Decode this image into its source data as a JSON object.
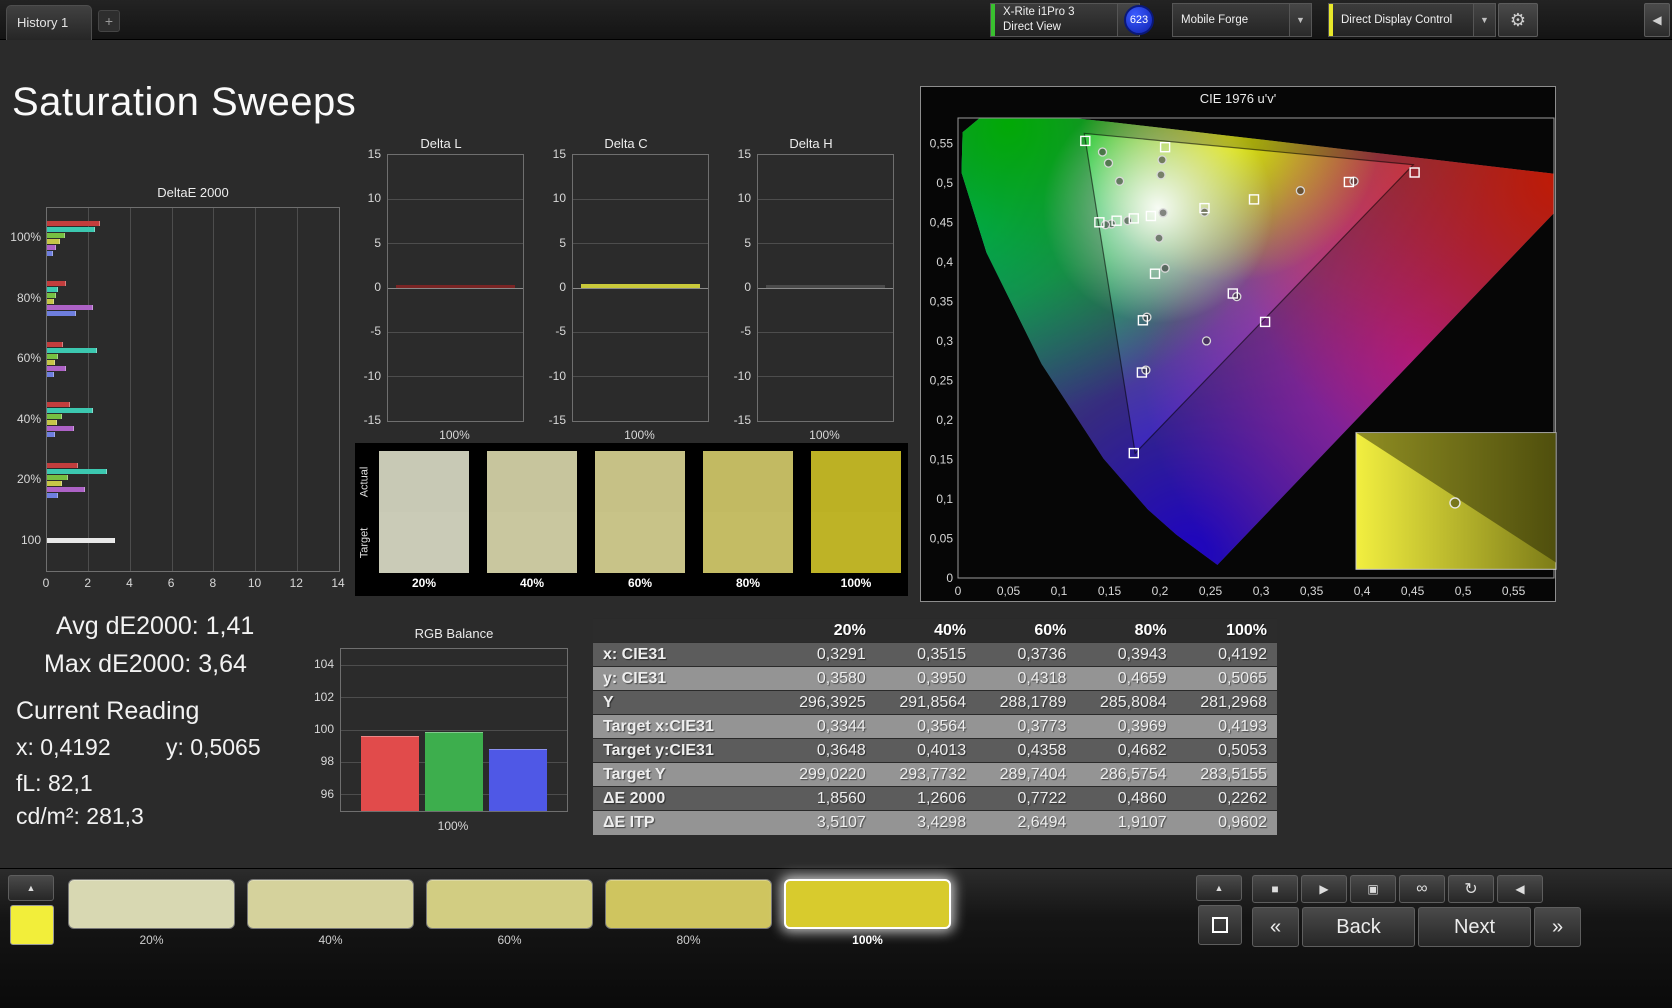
{
  "top_bar": {
    "tab_label": "History 1",
    "add_tab_label": "+",
    "meter_dropdown": {
      "line1": "X-Rite i1Pro 3",
      "line2": "Direct View",
      "accent": "#39c12f"
    },
    "badge_count": "623",
    "source_dropdown": {
      "label": "Mobile Forge"
    },
    "control_dropdown": {
      "label": "Direct Display Control",
      "accent": "#e8e82a"
    },
    "gear_icon": "⚙",
    "collapse_icon": "◀",
    "chevron_icon": "▼"
  },
  "page_title": "Saturation Sweeps",
  "stats": {
    "avg_de2000": "Avg dE2000: 1,41",
    "max_de2000": "Max dE2000: 3,64",
    "current_reading_label": "Current Reading",
    "x_value": "x: 0,4192",
    "y_value": "y: 0,5065",
    "fl_value": "fL: 82,1",
    "cdm2_value": "cd/m²: 281,3"
  },
  "chart_data": [
    {
      "id": "deltae2000",
      "type": "bar",
      "orientation": "horizontal",
      "title": "DeltaE 2000",
      "xlim": [
        0,
        14
      ],
      "xticks": [
        0,
        2,
        4,
        6,
        8,
        10,
        12,
        14
      ],
      "groups": [
        {
          "label": "100%",
          "bars": [
            {
              "color": "#c23d3d",
              "value": 2.55
            },
            {
              "color": "#3cc8b0",
              "value": 2.3
            },
            {
              "color": "#76bf42",
              "value": 0.85
            },
            {
              "color": "#c6c648",
              "value": 0.6
            },
            {
              "color": "#ad62c6",
              "value": 0.45
            },
            {
              "color": "#6e7ede",
              "value": 0.3
            }
          ]
        },
        {
          "label": "80%",
          "bars": [
            {
              "color": "#c23d3d",
              "value": 0.9
            },
            {
              "color": "#3cc8b0",
              "value": 0.55
            },
            {
              "color": "#76bf42",
              "value": 0.45
            },
            {
              "color": "#c6c648",
              "value": 0.35
            },
            {
              "color": "#ad62c6",
              "value": 2.2
            },
            {
              "color": "#6e7ede",
              "value": 1.4
            }
          ]
        },
        {
          "label": "60%",
          "bars": [
            {
              "color": "#c23d3d",
              "value": 0.75
            },
            {
              "color": "#3cc8b0",
              "value": 2.4
            },
            {
              "color": "#76bf42",
              "value": 0.55
            },
            {
              "color": "#c6c648",
              "value": 0.4
            },
            {
              "color": "#ad62c6",
              "value": 0.9
            },
            {
              "color": "#6e7ede",
              "value": 0.35
            }
          ]
        },
        {
          "label": "40%",
          "bars": [
            {
              "color": "#c23d3d",
              "value": 1.1
            },
            {
              "color": "#3cc8b0",
              "value": 2.2
            },
            {
              "color": "#76bf42",
              "value": 0.7
            },
            {
              "color": "#c6c648",
              "value": 0.5
            },
            {
              "color": "#ad62c6",
              "value": 1.3
            },
            {
              "color": "#6e7ede",
              "value": 0.4
            }
          ]
        },
        {
          "label": "20%",
          "bars": [
            {
              "color": "#c23d3d",
              "value": 1.5
            },
            {
              "color": "#3cc8b0",
              "value": 2.9
            },
            {
              "color": "#76bf42",
              "value": 1.0
            },
            {
              "color": "#c6c648",
              "value": 0.7
            },
            {
              "color": "#ad62c6",
              "value": 1.8
            },
            {
              "color": "#6e7ede",
              "value": 0.55
            }
          ]
        },
        {
          "label": "100",
          "bars": [
            {
              "color": "#e8e8e8",
              "value": 3.25
            }
          ]
        }
      ]
    },
    {
      "id": "delta_l",
      "type": "bar",
      "title": "Delta L",
      "categories": [
        "100%"
      ],
      "values": [
        0.15
      ],
      "bar_color": "#7a2424",
      "ylim": [
        -15,
        15
      ],
      "yticks": [
        15,
        10,
        5,
        0,
        -5,
        -10,
        -15
      ]
    },
    {
      "id": "delta_c",
      "type": "bar",
      "title": "Delta C",
      "categories": [
        "100%"
      ],
      "values": [
        0.45
      ],
      "bar_color": "#c9c93a",
      "ylim": [
        -15,
        15
      ],
      "yticks": [
        15,
        10,
        5,
        0,
        -5,
        -10,
        -15
      ]
    },
    {
      "id": "delta_h",
      "type": "bar",
      "title": "Delta H",
      "categories": [
        "100%"
      ],
      "values": [
        0.12
      ],
      "bar_color": "#4a4a4a",
      "ylim": [
        -15,
        15
      ],
      "yticks": [
        15,
        10,
        5,
        0,
        -5,
        -10,
        -15
      ]
    },
    {
      "id": "rgb_balance",
      "type": "bar",
      "title": "RGB Balance",
      "categories": [
        "Red",
        "Green",
        "Blue"
      ],
      "values": [
        99.6,
        99.9,
        98.8
      ],
      "colors": [
        "#e14b4b",
        "#3dae4d",
        "#4f58e6"
      ],
      "ylim": [
        95,
        105
      ],
      "yticks": [
        104,
        102,
        100,
        98,
        96
      ],
      "xlabel": "100%"
    },
    {
      "id": "cie1976",
      "type": "scatter",
      "title": "CIE 1976 u'v'",
      "xlim": [
        0,
        0.59
      ],
      "ylim": [
        0,
        0.582
      ],
      "tick_step": 0.05,
      "xtick_labels": [
        "0",
        "0,05",
        "0,1",
        "0,15",
        "0,2",
        "0,25",
        "0,3",
        "0,35",
        "0,4",
        "0,45",
        "0,5",
        "0,55"
      ],
      "ytick_labels": [
        "0",
        "0,05",
        "0,1",
        "0,15",
        "0,2",
        "0,25",
        "0,3",
        "0,35",
        "0,4",
        "0,45",
        "0,5",
        "0,55"
      ],
      "targets": [
        [
          0.126,
          0.553
        ],
        [
          0.205,
          0.545
        ],
        [
          0.452,
          0.513
        ],
        [
          0.387,
          0.501
        ],
        [
          0.293,
          0.479
        ],
        [
          0.244,
          0.468
        ],
        [
          0.14,
          0.45
        ],
        [
          0.157,
          0.452
        ],
        [
          0.174,
          0.455
        ],
        [
          0.191,
          0.458
        ],
        [
          0.195,
          0.385
        ],
        [
          0.183,
          0.326
        ],
        [
          0.272,
          0.36
        ],
        [
          0.304,
          0.324
        ],
        [
          0.182,
          0.26
        ],
        [
          0.174,
          0.158
        ]
      ],
      "measurements": [
        [
          0.143,
          0.539
        ],
        [
          0.149,
          0.525
        ],
        [
          0.16,
          0.502
        ],
        [
          0.202,
          0.529
        ],
        [
          0.201,
          0.51
        ],
        [
          0.392,
          0.502
        ],
        [
          0.339,
          0.49
        ],
        [
          0.244,
          0.463
        ],
        [
          0.203,
          0.462
        ],
        [
          0.152,
          0.448
        ],
        [
          0.146,
          0.447
        ],
        [
          0.168,
          0.452
        ],
        [
          0.199,
          0.43
        ],
        [
          0.205,
          0.392
        ],
        [
          0.187,
          0.33
        ],
        [
          0.276,
          0.356
        ],
        [
          0.246,
          0.3
        ],
        [
          0.186,
          0.263
        ]
      ],
      "inset": {
        "u": 0.394,
        "v": 0.011,
        "w": 0.198,
        "h": 0.173,
        "marker": [
          0.492,
          0.095
        ]
      }
    }
  ],
  "swatch_strip": {
    "row_labels": [
      "Actual",
      "Target"
    ],
    "columns": [
      {
        "label": "20%",
        "actual": "#c8c9b5",
        "target": "#cacbb7"
      },
      {
        "label": "40%",
        "actual": "#c7c59d",
        "target": "#c9c79f"
      },
      {
        "label": "60%",
        "actual": "#c6c186",
        "target": "#c8c388"
      },
      {
        "label": "80%",
        "actual": "#c2ba62",
        "target": "#c4bc64"
      },
      {
        "label": "100%",
        "actual": "#bcb124",
        "target": "#beb326"
      }
    ]
  },
  "table": {
    "header": [
      "",
      "20%",
      "40%",
      "60%",
      "80%",
      "100%"
    ],
    "rows": [
      {
        "label": "x: CIE31",
        "values": [
          "0,3291",
          "0,3515",
          "0,3736",
          "0,3943",
          "0,4192"
        ]
      },
      {
        "label": "y: CIE31",
        "values": [
          "0,3580",
          "0,3950",
          "0,4318",
          "0,4659",
          "0,5065"
        ]
      },
      {
        "label": "Y",
        "values": [
          "296,3925",
          "291,8564",
          "288,1789",
          "285,8084",
          "281,2968"
        ]
      },
      {
        "label": "Target x:CIE31",
        "values": [
          "0,3344",
          "0,3564",
          "0,3773",
          "0,3969",
          "0,4193"
        ]
      },
      {
        "label": "Target y:CIE31",
        "values": [
          "0,3648",
          "0,4013",
          "0,4358",
          "0,4682",
          "0,5053"
        ]
      },
      {
        "label": "Target Y",
        "values": [
          "299,0220",
          "293,7732",
          "289,7404",
          "286,5754",
          "283,5155"
        ]
      },
      {
        "label": "ΔE 2000",
        "values": [
          "1,8560",
          "1,2606",
          "0,7722",
          "0,4860",
          "0,2262"
        ]
      },
      {
        "label": "ΔE ITP",
        "values": [
          "3,5107",
          "3,4298",
          "2,6494",
          "1,9107",
          "0,9602"
        ]
      }
    ]
  },
  "bottom_bar": {
    "up_icon": "▲",
    "color_chip": "#f2ee3a",
    "swatches": [
      {
        "label": "20%",
        "color": "#d8d8b2",
        "selected": false
      },
      {
        "label": "40%",
        "color": "#d5d29c",
        "selected": false
      },
      {
        "label": "60%",
        "color": "#d2cd82",
        "selected": false
      },
      {
        "label": "80%",
        "color": "#cfc55f",
        "selected": false
      },
      {
        "label": "100%",
        "color": "#d8cb2d",
        "selected": true
      }
    ],
    "transport_buttons": [
      {
        "name": "stop",
        "glyph": "■"
      },
      {
        "name": "play",
        "glyph": "▶"
      },
      {
        "name": "save",
        "glyph": "▣"
      },
      {
        "name": "continuous",
        "glyph": "∞"
      },
      {
        "name": "refresh",
        "glyph": "↻"
      },
      {
        "name": "previous",
        "glyph": "◀"
      }
    ],
    "nav": {
      "back_label": "Back",
      "next_label": "Next",
      "back_chevron": "«",
      "next_chevron": "»"
    }
  }
}
